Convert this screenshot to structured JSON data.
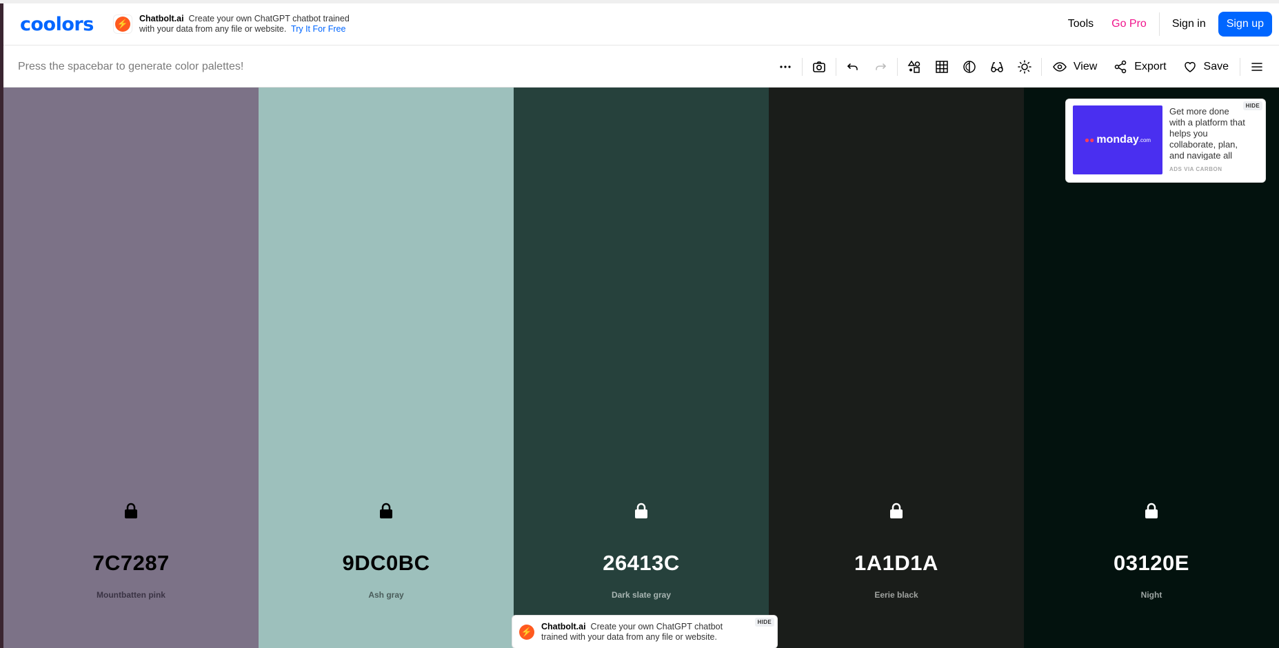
{
  "header": {
    "logo": "coolors",
    "ad": {
      "brand": "Chatbolt.ai",
      "text": "Create your own ChatGPT chatbot trained",
      "text2": "with your data from any file or website.",
      "cta": "Try It For Free"
    },
    "nav": {
      "tools": "Tools",
      "go_pro": "Go Pro",
      "sign_in": "Sign in",
      "sign_up": "Sign up"
    }
  },
  "toolbar": {
    "hint": "Press the spacebar to generate color palettes!",
    "view_label": "View",
    "export_label": "Export",
    "save_label": "Save",
    "icons": [
      "more-icon",
      "camera-icon",
      "undo-icon",
      "redo-icon",
      "shapes-icon",
      "grid-icon",
      "contrast-icon",
      "glasses-icon",
      "sun-icon",
      "eye-icon",
      "share-icon",
      "heart-icon",
      "menu-icon"
    ]
  },
  "palette": {
    "colors": [
      {
        "hex": "7C7287",
        "name": "Mountbatten pink",
        "bg": "#7c7287",
        "fg": "#000000",
        "name_color": "#3a3344"
      },
      {
        "hex": "9DC0BC",
        "name": "Ash gray",
        "bg": "#9dc0bc",
        "fg": "#000000",
        "name_color": "#4a5c5a"
      },
      {
        "hex": "26413C",
        "name": "Dark slate gray",
        "bg": "#26413c",
        "fg": "#ffffff",
        "name_color": "#a8b5b2"
      },
      {
        "hex": "1A1D1A",
        "name": "Eerie black",
        "bg": "#1a1d1a",
        "fg": "#ffffff",
        "name_color": "#a0a3a0"
      },
      {
        "hex": "03120E",
        "name": "Night",
        "bg": "#03120e",
        "fg": "#ffffff",
        "name_color": "#9da5a3"
      }
    ]
  },
  "carbon_ad": {
    "brand": "monday",
    "brand_suffix": ".com",
    "text": "Get more done with a platform that helps you collaborate, plan, and navigate all",
    "via": "ADS VIA CARBON",
    "hide": "HIDE"
  },
  "bottom_ad": {
    "brand": "Chatbolt.ai",
    "text": "Create your own ChatGPT chatbot",
    "text2": "trained with your data from any file or website.",
    "hide": "HIDE"
  }
}
